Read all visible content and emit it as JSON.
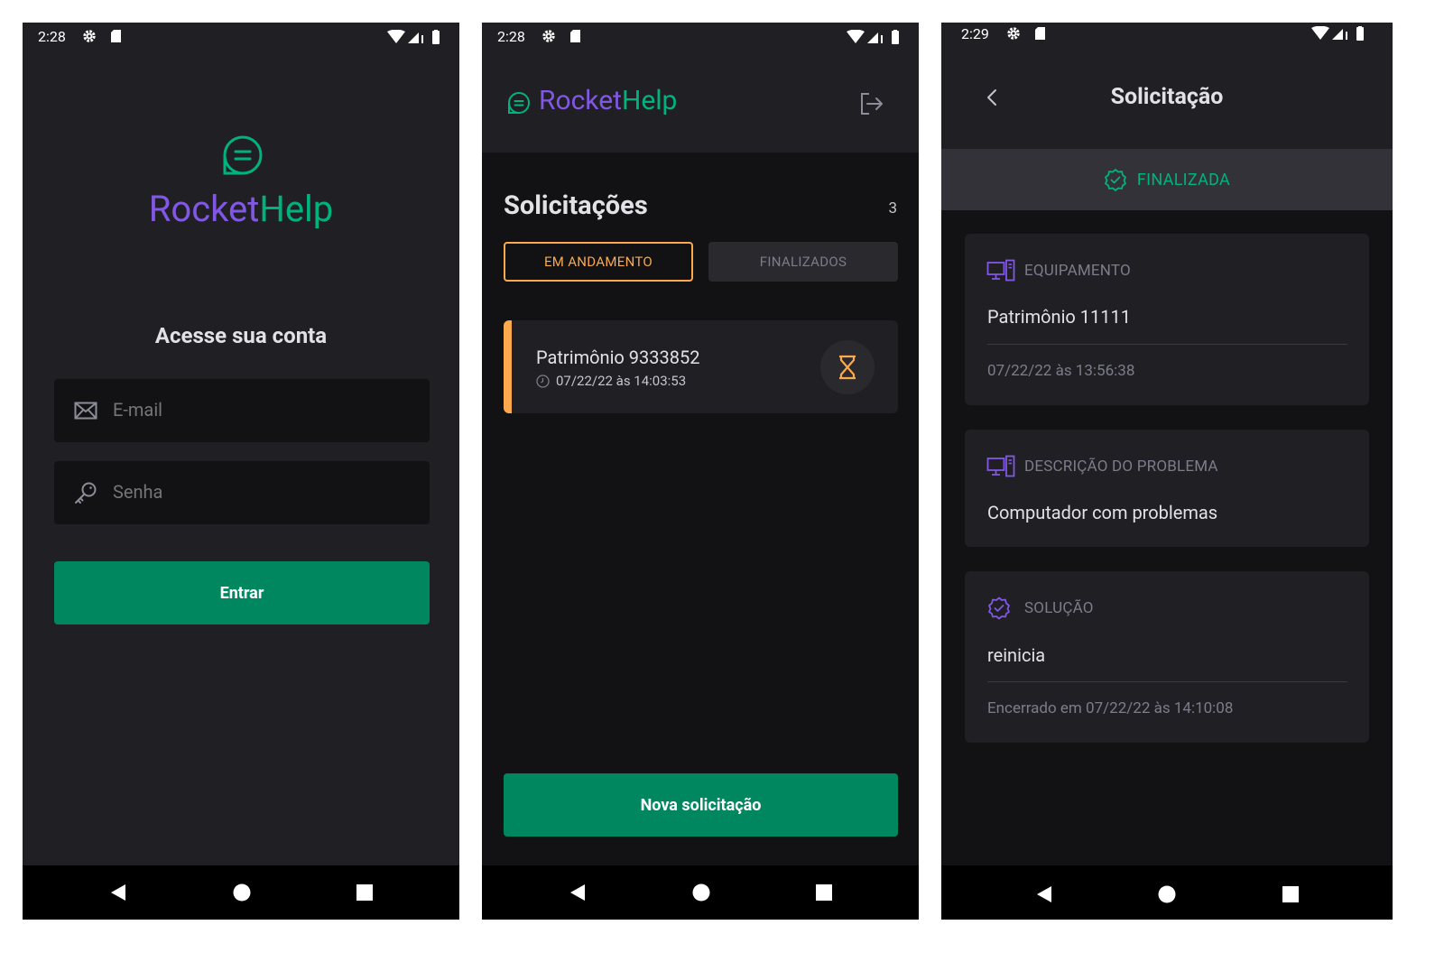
{
  "colors": {
    "brand_purple": "#8257e5",
    "brand_green": "#00b37e",
    "button_green": "#00875f",
    "accent_orange": "#fba94c",
    "background": "#202024",
    "surface_dark": "#121214"
  },
  "screens": [
    {
      "status": {
        "time": "2:28"
      },
      "logo": {
        "part1": "Rocket",
        "part2": "Help"
      },
      "heading": "Acesse sua conta",
      "email_placeholder": "E-mail",
      "password_placeholder": "Senha",
      "submit_label": "Entrar"
    },
    {
      "status": {
        "time": "2:28"
      },
      "logo": {
        "part1": "Rocket",
        "part2": "Help"
      },
      "title": "Solicitações",
      "count": "3",
      "tabs": {
        "active": "EM ANDAMENTO",
        "inactive": "FINALIZADOS"
      },
      "orders": [
        {
          "name": "Patrimônio 9333852",
          "date": "07/22/22 às 14:03:53",
          "status_icon": "hourglass-icon"
        }
      ],
      "new_button": "Nova solicitação"
    },
    {
      "status": {
        "time": "2:29"
      },
      "title": "Solicitação",
      "status_label": "FINALIZADA",
      "equipment": {
        "label": "EQUIPAMENTO",
        "value": "Patrimônio 11111",
        "date": "07/22/22 às 13:56:38"
      },
      "description": {
        "label": "DESCRIÇÃO DO PROBLEMA",
        "value": "Computador com problemas"
      },
      "solution": {
        "label": "SOLUÇÃO",
        "value": "reinicia",
        "closed": "Encerrado em 07/22/22 às 14:10:08"
      }
    }
  ]
}
